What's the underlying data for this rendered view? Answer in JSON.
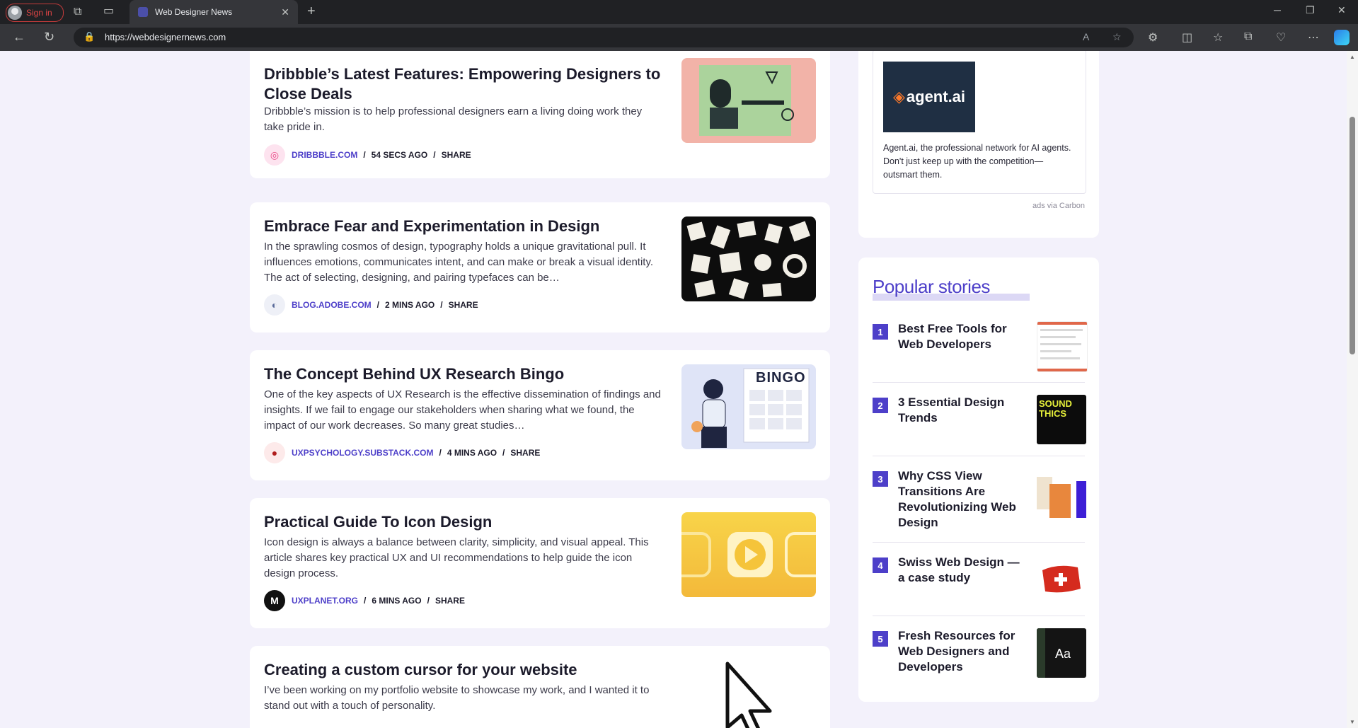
{
  "browser": {
    "profile_label": "Sign in",
    "tab_title": "Web Designer News",
    "url": "https://webdesignernews.com"
  },
  "articles": [
    {
      "title": "Dribbble’s Latest Features: Empowering Designers to Close Deals",
      "excerpt": "Dribbble’s mission is to help professional designers earn a living doing work they take pride in.",
      "source": "DRIBBBLE.COM",
      "time": "54 SECS AGO",
      "share": "SHARE"
    },
    {
      "title": "Embrace Fear and Experimentation in Design",
      "excerpt": "In the sprawling cosmos of design, typography holds a unique gravitational pull. It influences emotions, communicates intent, and can make or break a visual identity. The act of selecting, designing, and pairing typefaces can be…",
      "source": "BLOG.ADOBE.COM",
      "time": "2 MINS AGO",
      "share": "SHARE"
    },
    {
      "title": "The Concept Behind UX Research Bingo",
      "excerpt": "One of the key aspects of UX Research is the effective dissemination of findings and insights. If we fail to engage our stakeholders when sharing what we found, the impact of our work decreases. So many great studies…",
      "source": "UXPSYCHOLOGY.SUBSTACK.COM",
      "time": "4 MINS AGO",
      "share": "SHARE",
      "image_text": "BINGO"
    },
    {
      "title": "Practical Guide To Icon Design",
      "excerpt": "Icon design is always a balance between clarity, simplicity, and visual appeal. This article shares key practical UX and UI recommendations to help guide the icon design process.",
      "source": "UXPLANET.ORG",
      "time": "6 MINS AGO",
      "share": "SHARE"
    },
    {
      "title": "Creating a custom cursor for your website",
      "excerpt": "I’ve been working on my portfolio website to showcase my work, and I wanted it to stand out with a touch of personality."
    }
  ],
  "ad": {
    "logo_text": "agent.ai",
    "text": "Agent.ai, the professional network for AI agents. Don't just keep up with the competition—outsmart them.",
    "via": "ads via Carbon"
  },
  "popular": {
    "heading": "Popular stories",
    "items": [
      {
        "num": "1",
        "title": "Best Free Tools for Web Developers"
      },
      {
        "num": "2",
        "title": "3 Essential Design Trends",
        "thumb_text": "SOUND THICS"
      },
      {
        "num": "3",
        "title": "Why CSS View Transitions Are Revolutionizing Web Design"
      },
      {
        "num": "4",
        "title": "Swiss Web Design — a case study"
      },
      {
        "num": "5",
        "title": "Fresh Resources for Web Designers and Developers",
        "thumb_text": "Aa"
      }
    ]
  },
  "colors": {
    "accent": "#4d3fc9",
    "page_bg": "#f3f1fb",
    "chrome_bg": "#202124"
  }
}
